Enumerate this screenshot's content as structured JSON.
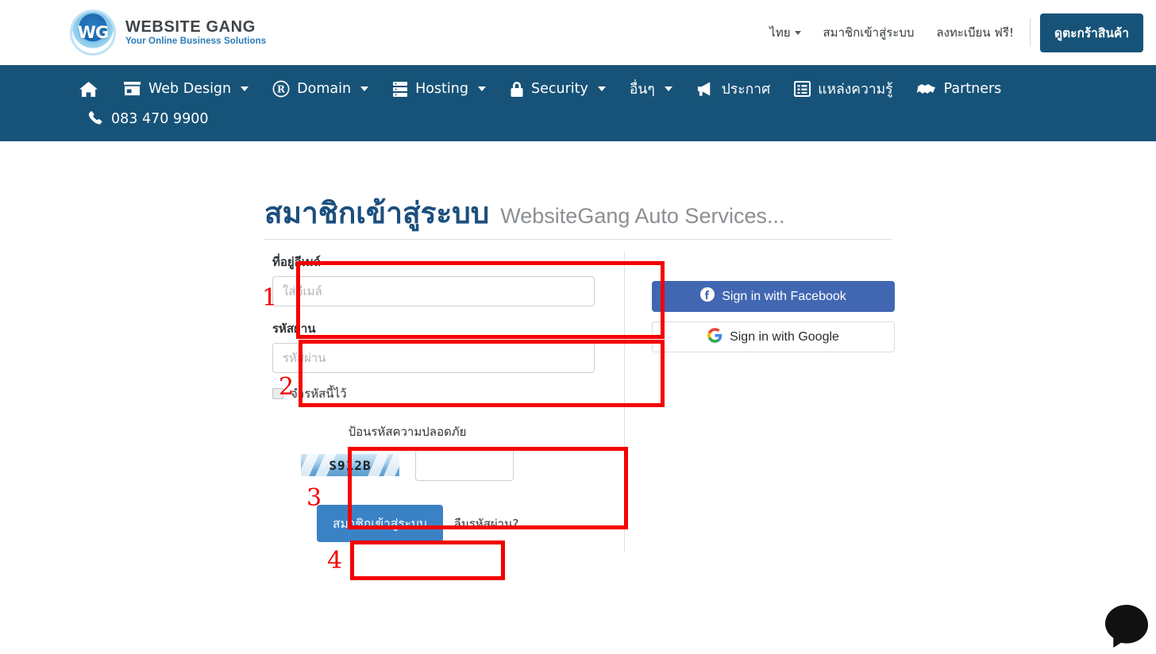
{
  "header": {
    "brand": {
      "logo_text": "WG",
      "name": "WEBSITE GANG",
      "tagline": "Your Online Business Solutions"
    },
    "nav_links": [
      {
        "label": "ไทย",
        "has_caret": true,
        "name": "language-selector"
      },
      {
        "label": "สมาชิกเข้าสู่ระบบ",
        "has_caret": false,
        "name": "login-link"
      },
      {
        "label": "ลงทะเบียน ฟรี!",
        "has_caret": false,
        "name": "register-link"
      }
    ],
    "cart_button": "ดูตะกร้าสินค้า"
  },
  "mainnav": {
    "items": [
      {
        "label": "",
        "icon": "home-icon",
        "caret": false
      },
      {
        "label": "Web Design",
        "icon": "store-icon",
        "caret": true
      },
      {
        "label": "Domain",
        "icon": "registered-icon",
        "caret": true
      },
      {
        "label": "Hosting",
        "icon": "server-icon",
        "caret": true
      },
      {
        "label": "Security",
        "icon": "lock-icon",
        "caret": true
      },
      {
        "label": "อื่นๆ",
        "icon": "",
        "caret": true
      },
      {
        "label": "ประกาศ",
        "icon": "bullhorn-icon",
        "caret": false
      },
      {
        "label": "แหล่งความรู้",
        "icon": "list-alt-icon",
        "caret": false
      },
      {
        "label": "Partners",
        "icon": "handshake-icon",
        "caret": false
      }
    ],
    "phone": "083 470 9900",
    "phone_icon": "phone-icon",
    "bg_color": "#175378"
  },
  "page": {
    "title": "สมาชิกเข้าสู่ระบบ",
    "subtitle": "WebsiteGang Auto Services..."
  },
  "form": {
    "email_label": "ที่อยู่อีเมล์",
    "email_placeholder": "ใส่อีเมล์",
    "email_value": "",
    "password_label": "รหัสผ่าน",
    "password_placeholder": "รหัสผ่าน",
    "password_value": "",
    "remember_label": "จำรหัสนี้ไว้",
    "remember_checked": false,
    "captcha_title": "ป้อนรหัสความปลอดภัย",
    "captcha_code": "S912B",
    "captcha_input_value": "",
    "captcha_input_placeholder": "",
    "submit_label": "สมาชิกเข้าสู่ระบบ",
    "forgot_label": "ลืมรหัสผ่าน?",
    "submit_color": "#3b82c4"
  },
  "social": {
    "facebook_label": "Sign in with Facebook",
    "facebook_icon": "facebook-icon",
    "facebook_color": "#4267b2",
    "google_label": "Sign in with Google",
    "google_icon": "google-icon"
  },
  "annotations": [
    {
      "number": "1",
      "target": "email-field-group"
    },
    {
      "number": "2",
      "target": "password-field-group"
    },
    {
      "number": "3",
      "target": "captcha-group"
    },
    {
      "number": "4",
      "target": "submit-button"
    }
  ],
  "annotation_color": "#f40000"
}
